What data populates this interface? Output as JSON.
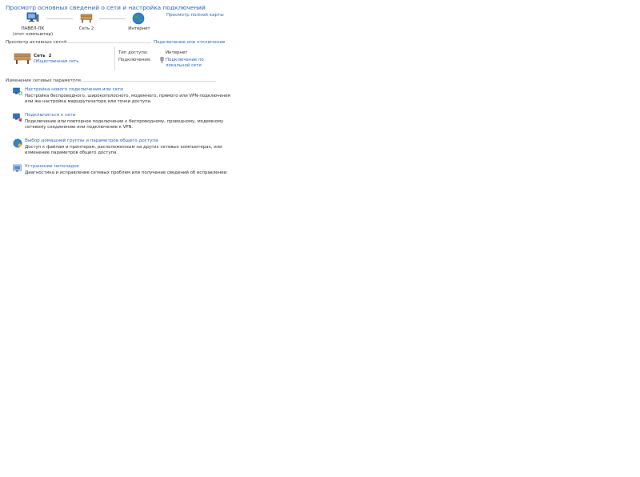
{
  "header": {
    "title": "Просмотр основных сведений о сети и настройка подключений",
    "full_map_link": "Просмотр полной карты"
  },
  "network_map": {
    "nodes": [
      {
        "label": "ПАВЕЛ-ПК",
        "sublabel": "(этот компьютер)",
        "icon": "computer-icon"
      },
      {
        "label": "Сеть 2",
        "sublabel": "",
        "icon": "public-network-bench-icon"
      },
      {
        "label": "Интернет",
        "sublabel": "",
        "icon": "globe-icon"
      }
    ]
  },
  "active_networks": {
    "section_title": "Просмотр активных сетей",
    "connect_disconnect_link": "Подключение или отключение",
    "network": {
      "name": "Сеть  2",
      "type_link": "Общественная сеть",
      "icon": "public-network-bench-icon"
    },
    "access_type_label": "Тип доступа:",
    "access_type_value": "Интернет",
    "connections_label": "Подключения:",
    "connection_link_line1": "Подключение по",
    "connection_link_line2": "локальной сети",
    "connection_icon": "ethernet-icon"
  },
  "change_settings": {
    "section_title": "Изменение сетевых параметров",
    "tasks": [
      {
        "icon": "new-connection-icon",
        "link": "Настройка нового подключения или сети",
        "desc_line1": "Настройка беспроводного, широкополосного, модемного, прямого или VPN-подключения",
        "desc_line2": "или же настройка маршрутизатора или точки доступа."
      },
      {
        "icon": "connect-to-network-icon",
        "link": "Подключиться к сети",
        "desc_line1": "Подключение или повторное подключение к беспроводному, проводному, модемному",
        "desc_line2": "сетевому соединению или подключение к VPN."
      },
      {
        "icon": "homegroup-sharing-icon",
        "link": "Выбор домашней группы и параметров общего доступа",
        "desc_line1": "Доступ к файлам и принтерам, расположенным на других сетевых компьютерах, или",
        "desc_line2": "изменение параметров общего доступа."
      },
      {
        "icon": "troubleshoot-icon",
        "link": "Устранение неполадок",
        "desc_line1": "Диагностика и исправление сетевых проблем или получение сведений об исправлении.",
        "desc_line2": ""
      }
    ]
  },
  "colors": {
    "link": "#1f5fb5",
    "text": "#1e1e1e",
    "rule": "#d6d6d6"
  }
}
